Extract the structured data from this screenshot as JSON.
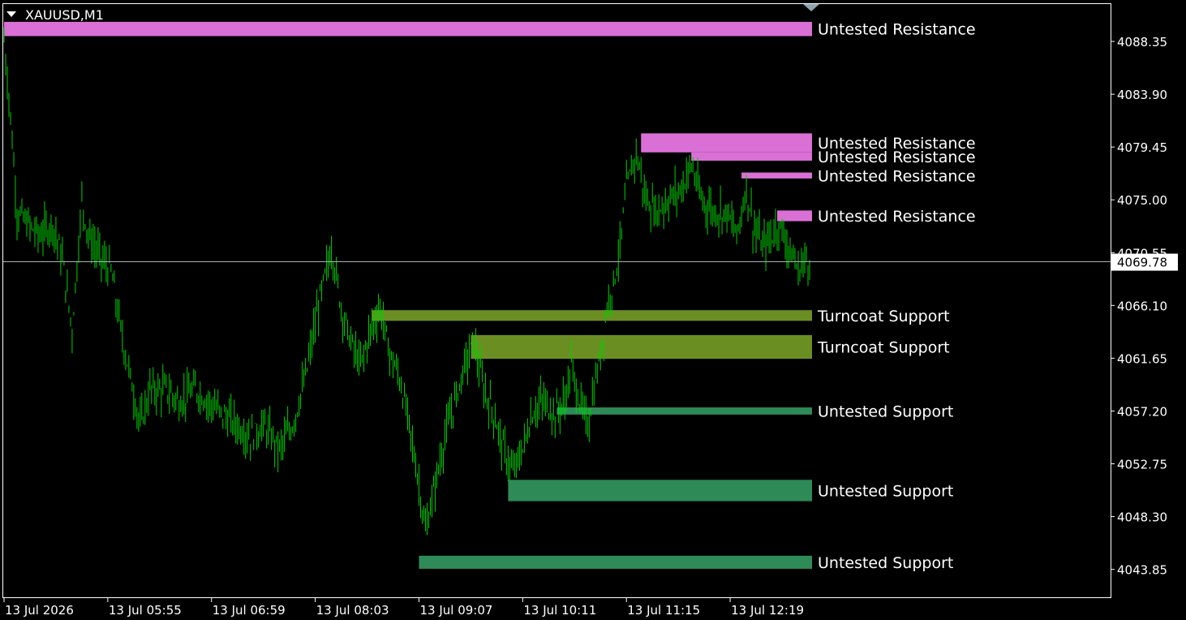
{
  "window": {
    "symbol_label": "XAUUSD,M1"
  },
  "colors": {
    "background": "#000000",
    "frame": "#ffffff",
    "bars": "#00d000",
    "resistance_zone": "#da70d6",
    "turncoat_zone": "#6b8e23",
    "support_zone": "#2e8b57",
    "current_price_line": "#a9b5b5"
  },
  "chart_data": {
    "type": "ohlc",
    "timeframe": "M1",
    "symbol": "XAUUSD",
    "current_price": 4069.78,
    "current_price_label": "4069.78",
    "y_range": [
      4041.5,
      4091.5
    ],
    "y_ticks": [
      "4088.35",
      "4083.90",
      "4079.45",
      "4075.00",
      "4070.55",
      "4066.10",
      "4061.65",
      "4057.20",
      "4052.75",
      "4048.30",
      "4043.85"
    ],
    "x_ticks": [
      "13 Jul 2026",
      "13 Jul 05:55",
      "13 Jul 06:59",
      "13 Jul 08:03",
      "13 Jul 09:07",
      "13 Jul 10:11",
      "13 Jul 11:15",
      "13 Jul 12:19"
    ],
    "x_tick_index": [
      0,
      64,
      128,
      192,
      256,
      320,
      384,
      448
    ],
    "bar_count": 498,
    "price_path": [
      [
        0,
        4088.5
      ],
      [
        4,
        4082
      ],
      [
        8,
        4074
      ],
      [
        14,
        4073
      ],
      [
        22,
        4072
      ],
      [
        30,
        4073
      ],
      [
        36,
        4070
      ],
      [
        42,
        4064
      ],
      [
        48,
        4075
      ],
      [
        52,
        4072
      ],
      [
        60,
        4070
      ],
      [
        66,
        4069
      ],
      [
        72,
        4064
      ],
      [
        78,
        4060
      ],
      [
        84,
        4056
      ],
      [
        90,
        4059
      ],
      [
        100,
        4059
      ],
      [
        108,
        4058
      ],
      [
        118,
        4059
      ],
      [
        126,
        4058
      ],
      [
        134,
        4057
      ],
      [
        144,
        4056
      ],
      [
        152,
        4055
      ],
      [
        160,
        4056
      ],
      [
        170,
        4054
      ],
      [
        178,
        4056
      ],
      [
        186,
        4060
      ],
      [
        194,
        4066
      ],
      [
        202,
        4071
      ],
      [
        208,
        4066
      ],
      [
        214,
        4063
      ],
      [
        220,
        4061
      ],
      [
        226,
        4064
      ],
      [
        232,
        4066
      ],
      [
        238,
        4062
      ],
      [
        244,
        4060
      ],
      [
        250,
        4056
      ],
      [
        256,
        4051
      ],
      [
        260,
        4047
      ],
      [
        266,
        4051
      ],
      [
        272,
        4055
      ],
      [
        278,
        4058
      ],
      [
        284,
        4061
      ],
      [
        290,
        4063
      ],
      [
        296,
        4059
      ],
      [
        302,
        4057
      ],
      [
        308,
        4054
      ],
      [
        314,
        4052
      ],
      [
        320,
        4054
      ],
      [
        326,
        4057
      ],
      [
        332,
        4058
      ],
      [
        340,
        4057
      ],
      [
        346,
        4058
      ],
      [
        350,
        4061
      ],
      [
        355,
        4058
      ],
      [
        360,
        4056
      ],
      [
        364,
        4059
      ],
      [
        368,
        4062
      ],
      [
        372,
        4066
      ],
      [
        376,
        4068
      ],
      [
        380,
        4071
      ],
      [
        384,
        4076
      ],
      [
        390,
        4079
      ],
      [
        396,
        4075
      ],
      [
        402,
        4074
      ],
      [
        410,
        4075
      ],
      [
        418,
        4076
      ],
      [
        424,
        4078
      ],
      [
        430,
        4075
      ],
      [
        438,
        4074
      ],
      [
        446,
        4074
      ],
      [
        452,
        4072
      ],
      [
        458,
        4076
      ],
      [
        462,
        4073
      ],
      [
        468,
        4071
      ],
      [
        474,
        4072
      ],
      [
        478,
        4073
      ],
      [
        484,
        4071
      ],
      [
        490,
        4069
      ],
      [
        494,
        4070
      ],
      [
        497,
        4070
      ]
    ],
    "zones": [
      {
        "label": "Untested Resistance",
        "kind": "resistance",
        "start_index": 0,
        "low": 4088.8,
        "high": 4090.0
      },
      {
        "label": "Untested Resistance",
        "kind": "resistance",
        "start_index": 393,
        "low": 4079.0,
        "high": 4080.6
      },
      {
        "label": "Untested Resistance",
        "kind": "resistance",
        "start_index": 424,
        "low": 4078.3,
        "high": 4079.0
      },
      {
        "label": "Untested Resistance",
        "kind": "resistance",
        "start_index": 455,
        "low": 4076.8,
        "high": 4077.3
      },
      {
        "label": "Untested Resistance",
        "kind": "resistance",
        "start_index": 477,
        "low": 4073.2,
        "high": 4074.1
      },
      {
        "label": "Turncoat Support",
        "kind": "turncoat",
        "start_index": 227,
        "low": 4064.8,
        "high": 4065.7
      },
      {
        "label": "Turncoat Support",
        "kind": "turncoat",
        "start_index": 288,
        "low": 4061.6,
        "high": 4063.6
      },
      {
        "label": "Untested Support",
        "kind": "support",
        "start_index": 341,
        "low": 4056.9,
        "high": 4057.5
      },
      {
        "label": "Untested Support",
        "kind": "support",
        "start_index": 311,
        "low": 4049.6,
        "high": 4051.4
      },
      {
        "label": "Untested Support",
        "kind": "support",
        "start_index": 256,
        "low": 4043.9,
        "high": 4045.0
      }
    ],
    "grid": false,
    "legend": "none"
  }
}
